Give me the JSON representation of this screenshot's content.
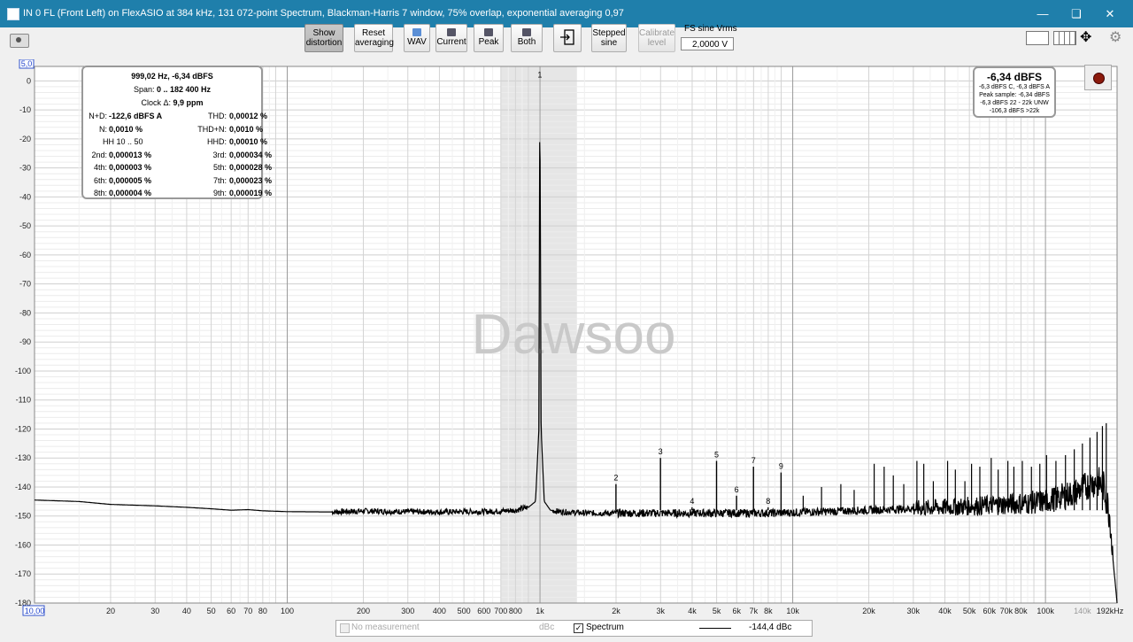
{
  "window": {
    "title": "IN 0 FL (Front Left) on FlexASIO at 384 kHz, 131 072-point Spectrum, Blackman-Harris 7 window, 75% overlap, exponential averaging 0,97",
    "minimize": "—",
    "restore": "❏",
    "close": "✕"
  },
  "toolbar": {
    "show_distortion": [
      "Show",
      "distortion"
    ],
    "reset_averaging": [
      "Reset",
      "averaging"
    ],
    "wav": "WAV",
    "current": "Current",
    "peak": "Peak",
    "both": "Both",
    "stepped_sine": [
      "Stepped",
      "sine"
    ],
    "calibrate_level": [
      "Calibrate",
      "level"
    ],
    "fs_label": "FS sine Vrms",
    "fs_value": "2,0000 V"
  },
  "infobox": {
    "header": "999,02 Hz, -6,34 dBFS",
    "span_label": "Span:",
    "span_value": "0 .. 182 400 Hz",
    "clock_label": "Clock Δ:",
    "clock_value": "9,9 ppm",
    "rows": [
      {
        "l1": "N+D:",
        "v1": "-122,6 dBFS A",
        "l2": "THD:",
        "v2": "0,00012 %"
      },
      {
        "l1": "N:",
        "v1": "0,0010 %",
        "l2": "THD+N:",
        "v2": "0,0010 %"
      },
      {
        "l1": "HH 10 .. 50",
        "v1": "",
        "l2": "HHD:",
        "v2": "0,00010 %"
      },
      {
        "l1": "2nd:",
        "v1": "0,000013 %",
        "l2": "3rd:",
        "v2": "0,000034 %"
      },
      {
        "l1": "4th:",
        "v1": "0,000003 %",
        "l2": "5th:",
        "v2": "0,000028 %"
      },
      {
        "l1": "6th:",
        "v1": "0,000005 %",
        "l2": "7th:",
        "v2": "0,000023 %"
      },
      {
        "l1": "8th:",
        "v1": "0,000004 %",
        "l2": "9th:",
        "v2": "0,000019 %"
      }
    ]
  },
  "levels": {
    "main": "-6,34 dBFS",
    "lines": [
      "-6,3 dBFS C, -6,3 dBFS A",
      "Peak sample: -6,34 dBFS",
      "-6,3 dBFS 22 - 22k UNW",
      "-106,3 dBFS >22k"
    ]
  },
  "watermark": "Dawsoo",
  "chart_data": {
    "type": "line",
    "title": "",
    "xlabel": "",
    "ylabel": "dBc",
    "x_scale": "log",
    "xlim": [
      10,
      192000
    ],
    "ylim": [
      -180,
      5
    ],
    "grid": true,
    "y_ticks": [
      0,
      -10,
      -20,
      -30,
      -40,
      -50,
      -60,
      -70,
      -80,
      -90,
      -100,
      -110,
      -120,
      -130,
      -140,
      -150,
      -160,
      -170,
      -180
    ],
    "y_top_label": "5,0",
    "x_tick_labels": [
      {
        "v": 10,
        "t": "10,00"
      },
      {
        "v": 20,
        "t": "20"
      },
      {
        "v": 30,
        "t": "30"
      },
      {
        "v": 40,
        "t": "40"
      },
      {
        "v": 50,
        "t": "50"
      },
      {
        "v": 60,
        "t": "60"
      },
      {
        "v": 70,
        "t": "70"
      },
      {
        "v": 80,
        "t": "80"
      },
      {
        "v": 100,
        "t": "100"
      },
      {
        "v": 200,
        "t": "200"
      },
      {
        "v": 300,
        "t": "300"
      },
      {
        "v": 400,
        "t": "400"
      },
      {
        "v": 500,
        "t": "500"
      },
      {
        "v": 600,
        "t": "600"
      },
      {
        "v": 700,
        "t": "700"
      },
      {
        "v": 800,
        "t": "800"
      },
      {
        "v": 1000,
        "t": "1k"
      },
      {
        "v": 2000,
        "t": "2k"
      },
      {
        "v": 3000,
        "t": "3k"
      },
      {
        "v": 4000,
        "t": "4k"
      },
      {
        "v": 5000,
        "t": "5k"
      },
      {
        "v": 6000,
        "t": "6k"
      },
      {
        "v": 7000,
        "t": "7k"
      },
      {
        "v": 8000,
        "t": "8k"
      },
      {
        "v": 10000,
        "t": "10k"
      },
      {
        "v": 20000,
        "t": "20k"
      },
      {
        "v": 30000,
        "t": "30k"
      },
      {
        "v": 40000,
        "t": "40k"
      },
      {
        "v": 50000,
        "t": "50k"
      },
      {
        "v": 60000,
        "t": "60k"
      },
      {
        "v": 70000,
        "t": "70k"
      },
      {
        "v": 80000,
        "t": "80k"
      },
      {
        "v": 100000,
        "t": "100k"
      },
      {
        "v": 140000,
        "t": "140k"
      },
      {
        "v": 192000,
        "t": "192kHz"
      }
    ],
    "highlight_band": [
      700,
      1400
    ],
    "series": [
      {
        "name": "Spectrum",
        "color": "#000000",
        "x": [
          10,
          15,
          20,
          30,
          40,
          50,
          60,
          70,
          80,
          100,
          150,
          200,
          300,
          400,
          500,
          600,
          700,
          800,
          900,
          960,
          990,
          999,
          1010,
          1040,
          1100,
          1200,
          1500,
          2000,
          3000,
          5000,
          8000,
          10000,
          20000,
          40000,
          70000,
          100000,
          130000,
          150000,
          160000,
          170000,
          180000,
          185000,
          192000
        ],
        "values": [
          -144.5,
          -145,
          -146,
          -146.5,
          -147,
          -147.5,
          -148,
          -147.8,
          -148.2,
          -148.5,
          -148.6,
          -148.3,
          -148.5,
          -148.6,
          -148.5,
          -148.5,
          -148.3,
          -148,
          -147,
          -145,
          -120,
          0,
          -120,
          -145,
          -148,
          -148.5,
          -149,
          -149,
          -149,
          -149,
          -149,
          -148.8,
          -148,
          -147,
          -146,
          -145,
          -142,
          -139,
          -138,
          -140,
          -150,
          -165,
          -180
        ]
      }
    ],
    "harmonics": [
      {
        "n": "1",
        "f": 999,
        "db": 0
      },
      {
        "n": "2",
        "f": 1998,
        "db": -139
      },
      {
        "n": "3",
        "f": 2997,
        "db": -130
      },
      {
        "n": "4",
        "f": 3996,
        "db": -147
      },
      {
        "n": "5",
        "f": 4995,
        "db": -131
      },
      {
        "n": "6",
        "f": 5994,
        "db": -143
      },
      {
        "n": "7",
        "f": 6993,
        "db": -133
      },
      {
        "n": "8",
        "f": 7992,
        "db": -147
      },
      {
        "n": "9",
        "f": 8991,
        "db": -135
      }
    ],
    "spurs": [
      {
        "f": 11000,
        "db": -143
      },
      {
        "f": 13000,
        "db": -140
      },
      {
        "f": 15500,
        "db": -139
      },
      {
        "f": 17500,
        "db": -141
      },
      {
        "f": 21000,
        "db": -132
      },
      {
        "f": 23000,
        "db": -133
      },
      {
        "f": 25000,
        "db": -136
      },
      {
        "f": 27500,
        "db": -139
      },
      {
        "f": 31000,
        "db": -131
      },
      {
        "f": 33000,
        "db": -132
      },
      {
        "f": 36000,
        "db": -138
      },
      {
        "f": 41000,
        "db": -131
      },
      {
        "f": 44000,
        "db": -134
      },
      {
        "f": 48000,
        "db": -138
      },
      {
        "f": 51000,
        "db": -132
      },
      {
        "f": 55000,
        "db": -133
      },
      {
        "f": 61000,
        "db": -130
      },
      {
        "f": 65000,
        "db": -134
      },
      {
        "f": 71000,
        "db": -131
      },
      {
        "f": 75000,
        "db": -133
      },
      {
        "f": 81000,
        "db": -131
      },
      {
        "f": 88000,
        "db": -133
      },
      {
        "f": 95000,
        "db": -132
      },
      {
        "f": 101000,
        "db": -129
      },
      {
        "f": 110000,
        "db": -131
      },
      {
        "f": 120000,
        "db": -129
      },
      {
        "f": 130000,
        "db": -127
      },
      {
        "f": 140000,
        "db": -125
      },
      {
        "f": 150000,
        "db": -123
      },
      {
        "f": 160000,
        "db": -121
      },
      {
        "f": 168000,
        "db": -119
      },
      {
        "f": 174000,
        "db": -118
      }
    ]
  },
  "legend": {
    "no_measurement": "No measurement",
    "no_measurement_unit": "dBc",
    "spectrum_label": "Spectrum",
    "spectrum_value": "-144,4 dBc"
  }
}
